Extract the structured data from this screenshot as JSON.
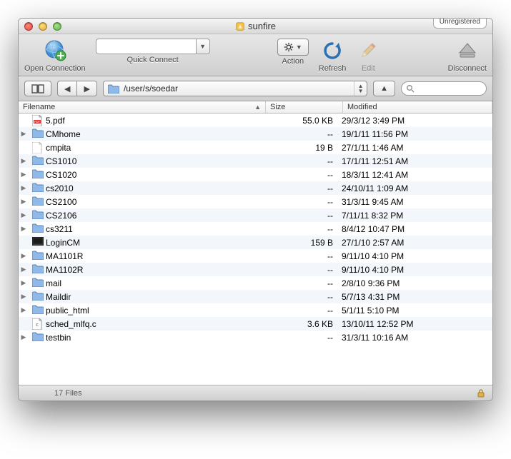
{
  "window": {
    "title": "sunfire",
    "badge": "Unregistered"
  },
  "toolbar": {
    "open_connection": "Open Connection",
    "quick_connect": "Quick Connect",
    "action": "Action",
    "refresh": "Refresh",
    "edit": "Edit",
    "disconnect": "Disconnect"
  },
  "path": "/user/s/soedar",
  "columns": {
    "filename": "Filename",
    "size": "Size",
    "modified": "Modified"
  },
  "files": [
    {
      "kind": "pdf",
      "expandable": false,
      "name": "5.pdf",
      "size": "55.0 KB",
      "modified": "29/3/12 3:49 PM"
    },
    {
      "kind": "folder",
      "expandable": true,
      "name": "CMhome",
      "size": "--",
      "modified": "19/1/11 11:56 PM"
    },
    {
      "kind": "file",
      "expandable": false,
      "name": "cmpita",
      "size": "19 B",
      "modified": "27/1/11 1:46 AM"
    },
    {
      "kind": "folder",
      "expandable": true,
      "name": "CS1010",
      "size": "--",
      "modified": "17/1/11 12:51 AM"
    },
    {
      "kind": "folder",
      "expandable": true,
      "name": "CS1020",
      "size": "--",
      "modified": "18/3/11 12:41 AM"
    },
    {
      "kind": "folder",
      "expandable": true,
      "name": "cs2010",
      "size": "--",
      "modified": "24/10/11 1:09 AM"
    },
    {
      "kind": "folder",
      "expandable": true,
      "name": "CS2100",
      "size": "--",
      "modified": "31/3/11 9:45 AM"
    },
    {
      "kind": "folder",
      "expandable": true,
      "name": "CS2106",
      "size": "--",
      "modified": "7/11/11 8:32 PM"
    },
    {
      "kind": "folder",
      "expandable": true,
      "name": "cs3211",
      "size": "--",
      "modified": "8/4/12 10:47 PM"
    },
    {
      "kind": "exec",
      "expandable": false,
      "name": "LoginCM",
      "size": "159 B",
      "modified": "27/1/10 2:57 AM"
    },
    {
      "kind": "folder",
      "expandable": true,
      "name": "MA1101R",
      "size": "--",
      "modified": "9/11/10 4:10 PM"
    },
    {
      "kind": "folder",
      "expandable": true,
      "name": "MA1102R",
      "size": "--",
      "modified": "9/11/10 4:10 PM"
    },
    {
      "kind": "folder",
      "expandable": true,
      "name": "mail",
      "size": "--",
      "modified": "2/8/10 9:36 PM"
    },
    {
      "kind": "folder",
      "expandable": true,
      "name": "Maildir",
      "size": "--",
      "modified": "5/7/13 4:31 PM"
    },
    {
      "kind": "folder",
      "expandable": true,
      "name": "public_html",
      "size": "--",
      "modified": "5/1/11 5:10 PM"
    },
    {
      "kind": "c",
      "expandable": false,
      "name": "sched_mlfq.c",
      "size": "3.6 KB",
      "modified": "13/10/11 12:52 PM"
    },
    {
      "kind": "folder",
      "expandable": true,
      "name": "testbin",
      "size": "--",
      "modified": "31/3/11 10:16 AM"
    }
  ],
  "status": "17 Files"
}
